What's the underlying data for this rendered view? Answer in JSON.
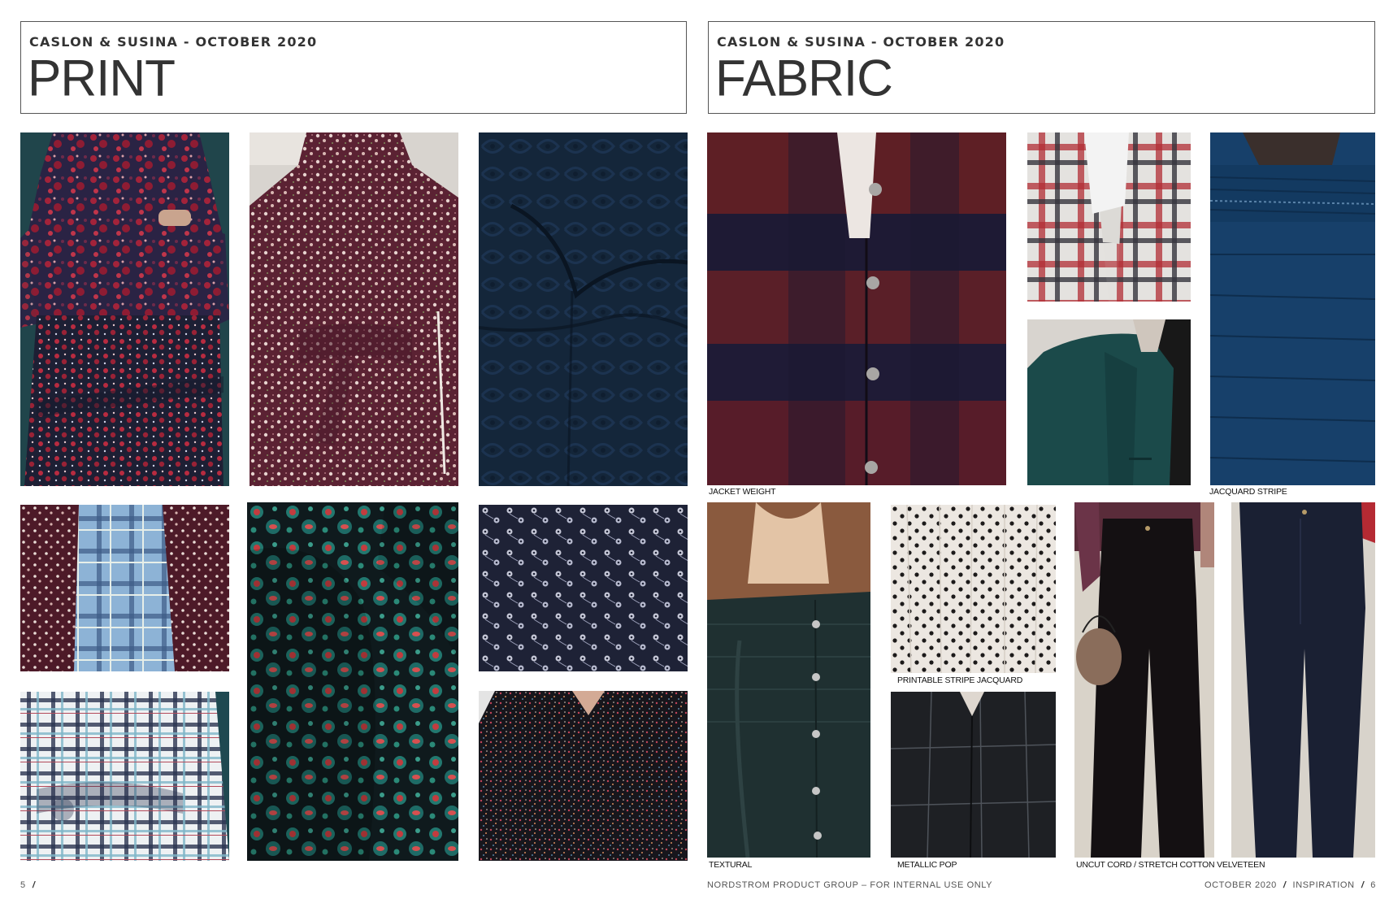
{
  "left_page": {
    "brand": "CASLON & SUSINA - OCTOBER 2020",
    "title": "PRINT",
    "page_number": "5",
    "photos": [
      {
        "name": "photo-floral-peplum-top",
        "desc": "red floral print peplum blouse and tiered skirt on navy"
      },
      {
        "name": "photo-burgundy-ditsy-blouse",
        "desc": "burgundy ditsy floral high-neck blouse with tie"
      },
      {
        "name": "photo-navy-tonal-print",
        "desc": "dark navy tonal paisley garment"
      },
      {
        "name": "photo-plaid-and-floral",
        "desc": "blue plaid panel between burgundy floral fabric"
      },
      {
        "name": "photo-green-paisley-floral",
        "desc": "teal green and red floral paisley dress"
      },
      {
        "name": "photo-navy-white-floral",
        "desc": "navy fabric with small white floral motif"
      },
      {
        "name": "photo-plaid-shirt-dress",
        "desc": "blue, white and navy plaid tie-waist shirt dress"
      },
      {
        "name": "photo-dark-ditsy-blouse",
        "desc": "black blouse with tiny multicolor ditsy floral"
      }
    ]
  },
  "right_page": {
    "brand": "CASLON & SUSINA - OCTOBER 2020",
    "title": "FABRIC",
    "photos": [
      {
        "name": "photo-jacket-weight",
        "caption": "JACKET WEIGHT"
      },
      {
        "name": "photo-plaid-scarf",
        "caption": ""
      },
      {
        "name": "photo-green-coat",
        "caption": ""
      },
      {
        "name": "photo-jacquard-stripe",
        "caption": "JACQUARD STRIPE"
      },
      {
        "name": "photo-textural",
        "caption": "TEXTURAL"
      },
      {
        "name": "photo-printable-stripe-jacquard",
        "caption": "PRINTABLE STRIPE JACQUARD"
      },
      {
        "name": "photo-metallic-pop",
        "caption": "METALLIC POP"
      },
      {
        "name": "photo-uncut-cord",
        "caption": "UNCUT CORD / STRETCH COTTON VELVETEEN"
      },
      {
        "name": "photo-velveteen-jeans",
        "caption": ""
      }
    ]
  },
  "footer": {
    "center": "NORDSTROM PRODUCT GROUP – FOR INTERNAL USE ONLY",
    "right_date": "OCTOBER 2020",
    "right_section": "INSPIRATION",
    "right_page_number": "6"
  },
  "colors": {
    "burgundy": "#5c1f2e",
    "navy": "#1b2838",
    "teal": "#1e4a4f",
    "red": "#b3263a",
    "rule": "#555555"
  }
}
